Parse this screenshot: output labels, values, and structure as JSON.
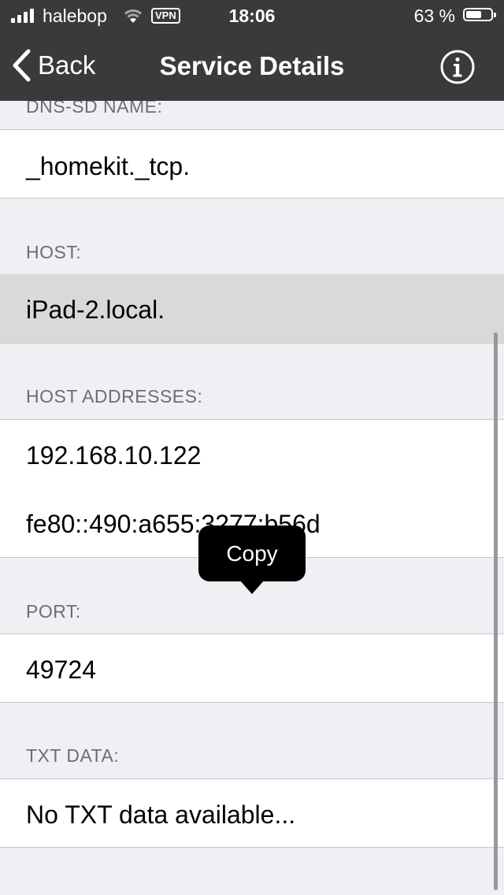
{
  "status_bar": {
    "carrier": "halebop",
    "vpn": "VPN",
    "time": "18:06",
    "battery_percent": "63 %",
    "battery_level": 0.63
  },
  "nav": {
    "back_label": "Back",
    "title": "Service Details",
    "info_icon": "info-icon"
  },
  "sections": {
    "dns_sd_name": {
      "header": "DNS-SD NAME:",
      "value": "_homekit._tcp."
    },
    "host": {
      "header": "HOST:",
      "value": "iPad-2.local."
    },
    "host_addresses": {
      "header": "HOST ADDRESSES:",
      "values": [
        "192.168.10.122",
        "fe80::490:a655:3277:b56d"
      ]
    },
    "port": {
      "header": "PORT:",
      "value": "49724"
    },
    "txt_data": {
      "header": "TXT DATA:",
      "value": "No TXT data available..."
    }
  },
  "popup": {
    "label": "Copy"
  },
  "colors": {
    "nav_background": "#3a3a3a",
    "page_background": "#efeff4",
    "section_header": "#6d6d72",
    "selected_cell": "#d9d9d9"
  }
}
